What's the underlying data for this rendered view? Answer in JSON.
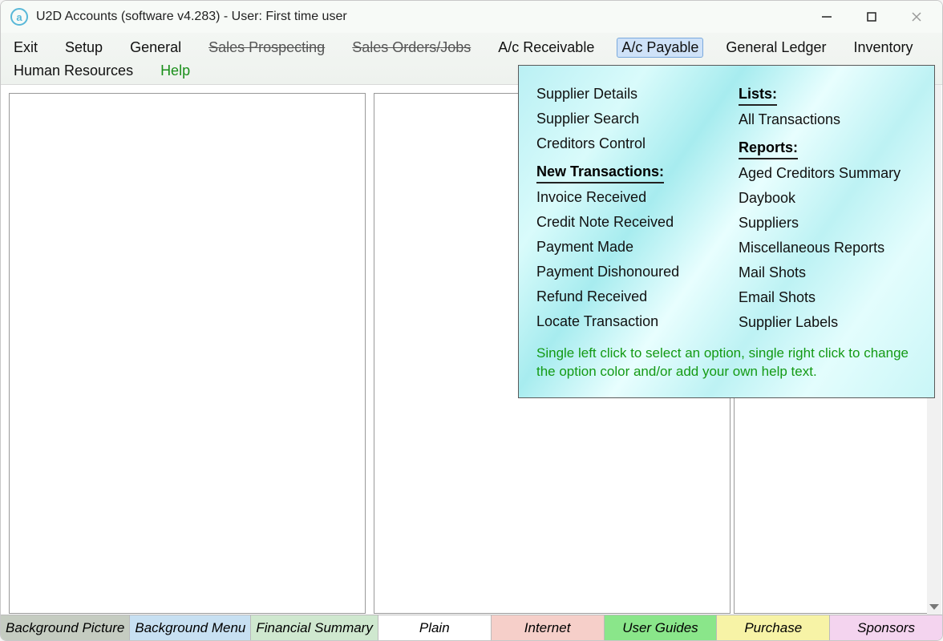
{
  "window": {
    "title": "U2D Accounts (software v4.283) -  User: First time user"
  },
  "menubar": {
    "items": [
      {
        "label": "Exit",
        "style": "normal"
      },
      {
        "label": "Setup",
        "style": "normal"
      },
      {
        "label": "General",
        "style": "normal"
      },
      {
        "label": "Sales Prospecting",
        "style": "strike"
      },
      {
        "label": "Sales Orders/Jobs",
        "style": "strike"
      },
      {
        "label": "A/c Receivable",
        "style": "normal"
      },
      {
        "label": "A/c Payable",
        "style": "active"
      },
      {
        "label": "General Ledger",
        "style": "normal"
      },
      {
        "label": "Inventory",
        "style": "normal"
      },
      {
        "label": "Human Resources",
        "style": "normal"
      },
      {
        "label": "Help",
        "style": "help"
      }
    ]
  },
  "dropdown": {
    "col1": {
      "top_items": [
        "Supplier Details",
        "Supplier Search",
        "Creditors Control"
      ],
      "heading": "New Transactions:",
      "items": [
        "Invoice Received",
        "Credit Note Received",
        "Payment Made",
        "Payment Dishonoured",
        "Refund Received",
        "Locate Transaction"
      ]
    },
    "col2": {
      "heading1": "Lists:",
      "items1": [
        "All Transactions"
      ],
      "heading2": "Reports:",
      "items2": [
        "Aged Creditors Summary",
        "Daybook",
        "Suppliers",
        "Miscellaneous Reports",
        "Mail Shots",
        "Email Shots",
        "Supplier Labels"
      ]
    },
    "help_text": "Single left click to select an option, single right click to change the option color and/or add your own help text."
  },
  "bottom_tabs": [
    {
      "label": "Background Picture",
      "color": "#c5ccc1"
    },
    {
      "label": "Background Menu",
      "color": "#c7e0f2"
    },
    {
      "label": "Financial Summary",
      "color": "#cfe8cf"
    },
    {
      "label": "Plain",
      "color": "#ffffff"
    },
    {
      "label": "Internet",
      "color": "#f6cfc9"
    },
    {
      "label": "User Guides",
      "color": "#8ae68a"
    },
    {
      "label": "Purchase",
      "color": "#f7f3a6"
    },
    {
      "label": "Sponsors",
      "color": "#f4d4ef"
    }
  ]
}
